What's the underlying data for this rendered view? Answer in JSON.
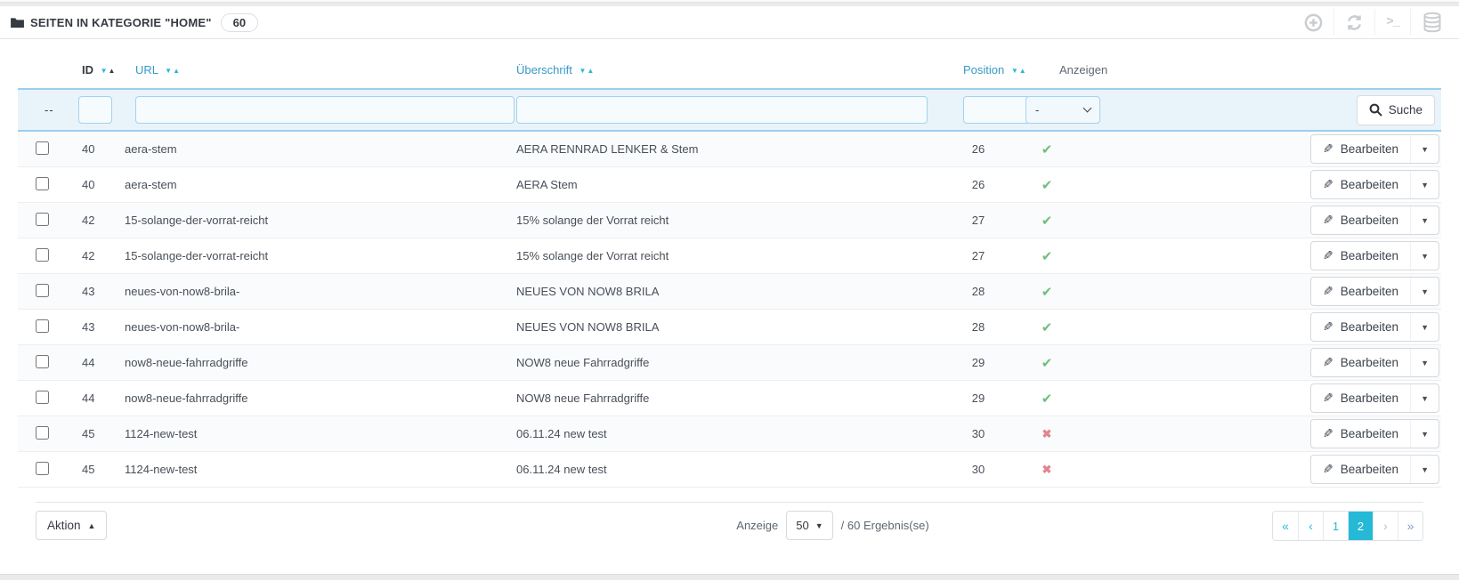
{
  "panel": {
    "title": "SEITEN IN KATEGORIE \"HOME\"",
    "count_badge": "60"
  },
  "toolbar": {
    "terminal_glyph": ">_"
  },
  "table": {
    "columns": [
      {
        "label": "ID"
      },
      {
        "label": "URL"
      },
      {
        "label": "Überschrift"
      },
      {
        "label": "Position"
      },
      {
        "label": "Anzeigen"
      }
    ],
    "sort_icons": {
      "desc": "▼",
      "asc": "▲"
    },
    "filter": {
      "select_all_placeholder": "--",
      "select_value": "-",
      "search_button": "Suche"
    },
    "edit_button_label": "Bearbeiten",
    "status_icons": {
      "visible": "✔",
      "hidden": "✖"
    },
    "edit_icon": "✎",
    "rows": [
      {
        "id": "40",
        "url": "aera-stem",
        "title": "AERA RENNRAD LENKER & Stem",
        "position": "26",
        "visible": true
      },
      {
        "id": "40",
        "url": "aera-stem",
        "title": "AERA Stem",
        "position": "26",
        "visible": true
      },
      {
        "id": "42",
        "url": "15-solange-der-vorrat-reicht",
        "title": "15% solange der Vorrat reicht",
        "position": "27",
        "visible": true
      },
      {
        "id": "42",
        "url": "15-solange-der-vorrat-reicht",
        "title": "15% solange der Vorrat reicht",
        "position": "27",
        "visible": true
      },
      {
        "id": "43",
        "url": "neues-von-now8-brila-",
        "title": "NEUES VON NOW8 BRILA",
        "position": "28",
        "visible": true
      },
      {
        "id": "43",
        "url": "neues-von-now8-brila-",
        "title": "NEUES VON NOW8 BRILA",
        "position": "28",
        "visible": true
      },
      {
        "id": "44",
        "url": "now8-neue-fahrradgriffe",
        "title": "NOW8 neue Fahrradgriffe",
        "position": "29",
        "visible": true
      },
      {
        "id": "44",
        "url": "now8-neue-fahrradgriffe",
        "title": "NOW8 neue Fahrradgriffe",
        "position": "29",
        "visible": true
      },
      {
        "id": "45",
        "url": "1124-new-test",
        "title": "06.11.24 new test",
        "position": "30",
        "visible": false
      },
      {
        "id": "45",
        "url": "1124-new-test",
        "title": "06.11.24 new test",
        "position": "30",
        "visible": false
      }
    ]
  },
  "footer": {
    "bulk_action_label": "Aktion",
    "display_label": "Anzeige",
    "page_size": "50",
    "results_text": "/ 60 Ergebnis(se)",
    "pagination": {
      "first": "«",
      "prev": "‹",
      "pages": [
        "1",
        "2"
      ],
      "active_page": "2",
      "next": "›",
      "last": "»"
    }
  },
  "colors": {
    "accent_blue": "#25b9d7",
    "header_link_blue": "#3799c6",
    "filter_bg": "#e9f3fa",
    "filter_border": "#9ccfee",
    "status_green": "#6fbf7a",
    "status_red": "#e2868e",
    "title_dark": "#363a41"
  }
}
